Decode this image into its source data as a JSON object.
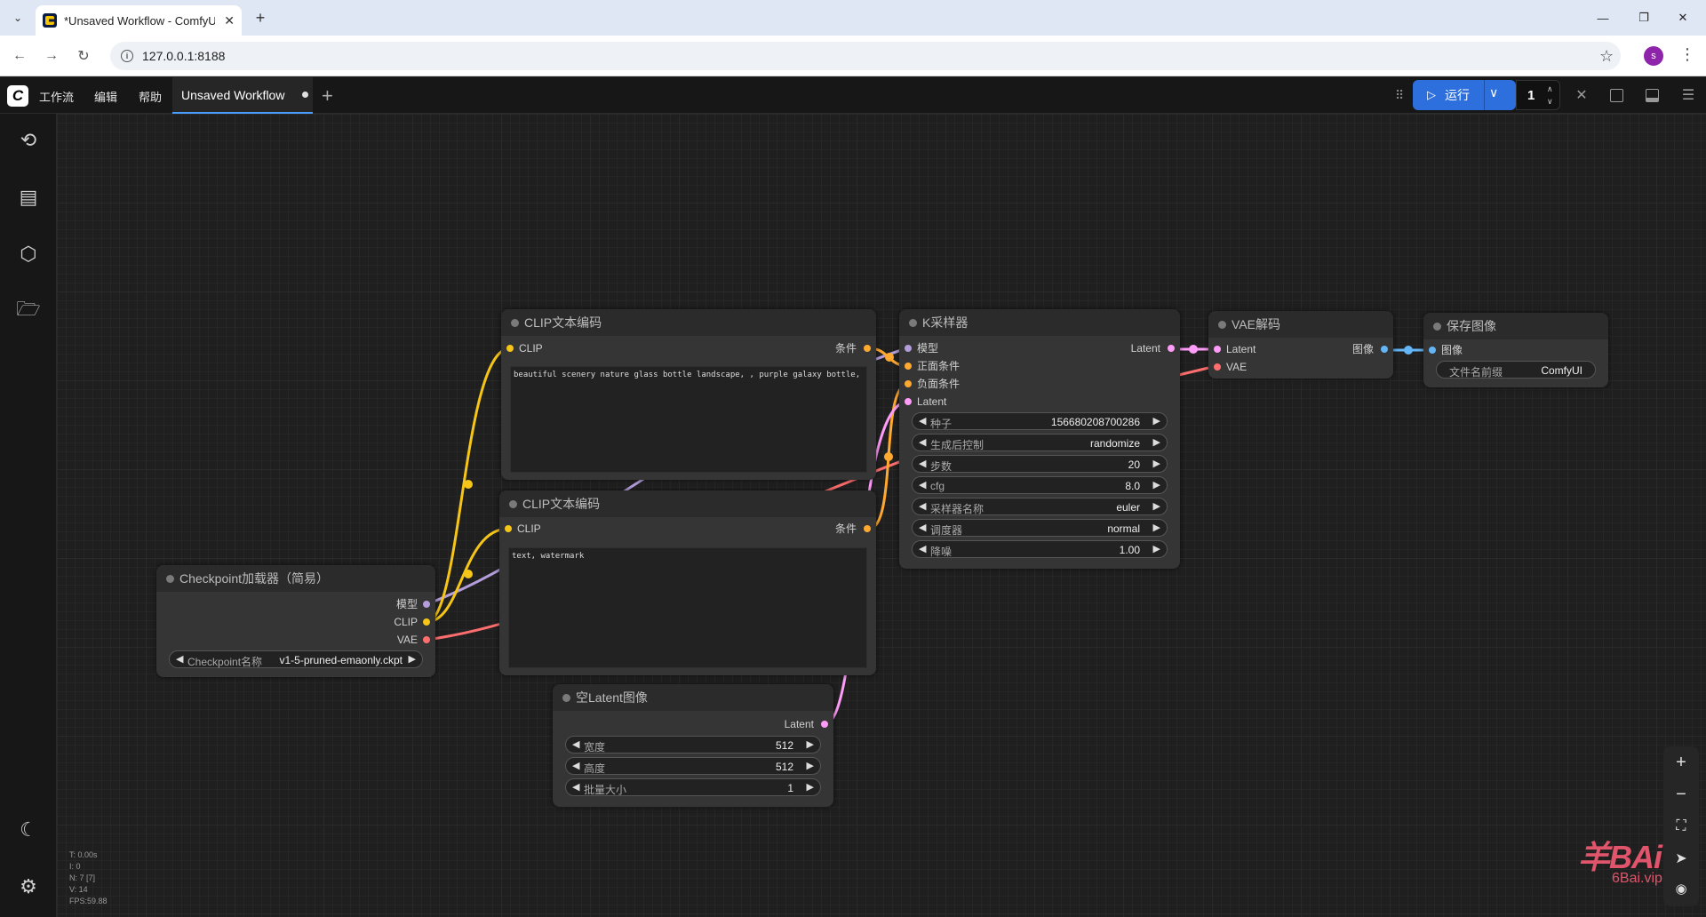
{
  "browser": {
    "tab_title": "*Unsaved Workflow - ComfyUI",
    "url": "127.0.0.1:8188",
    "profile_initial": "s"
  },
  "menubar": {
    "items": [
      "工作流",
      "编辑",
      "帮助"
    ],
    "workflow_tab": "Unsaved Workflow",
    "run_label": "运行",
    "batch_count": "1"
  },
  "nodes": {
    "clip1": {
      "title": "CLIP文本编码",
      "input": "CLIP",
      "output": "条件",
      "text": "beautiful scenery nature glass bottle landscape, , purple galaxy bottle,"
    },
    "clip2": {
      "title": "CLIP文本编码",
      "input": "CLIP",
      "output": "条件",
      "text": "text, watermark"
    },
    "checkpoint": {
      "title": "Checkpoint加载器（简易）",
      "outputs": [
        "模型",
        "CLIP",
        "VAE"
      ],
      "widget_label": "Checkpoint名称",
      "widget_value": "v1-5-pruned-emaonly.ckpt"
    },
    "ksampler": {
      "title": "K采样器",
      "inputs": [
        "模型",
        "正面条件",
        "负面条件",
        "Latent"
      ],
      "output": "Latent",
      "widgets": [
        {
          "label": "种子",
          "value": "156680208700286"
        },
        {
          "label": "生成后控制",
          "value": "randomize"
        },
        {
          "label": "步数",
          "value": "20"
        },
        {
          "label": "cfg",
          "value": "8.0"
        },
        {
          "label": "采样器名称",
          "value": "euler"
        },
        {
          "label": "调度器",
          "value": "normal"
        },
        {
          "label": "降噪",
          "value": "1.00"
        }
      ]
    },
    "vae": {
      "title": "VAE解码",
      "inputs": [
        "Latent",
        "VAE"
      ],
      "output": "图像"
    },
    "save": {
      "title": "保存图像",
      "input": "图像",
      "widget_label": "文件名前缀",
      "widget_value": "ComfyUI"
    },
    "latent": {
      "title": "空Latent图像",
      "output": "Latent",
      "widgets": [
        {
          "label": "宽度",
          "value": "512"
        },
        {
          "label": "高度",
          "value": "512"
        },
        {
          "label": "批量大小",
          "value": "1"
        }
      ]
    }
  },
  "stats": [
    "T: 0.00s",
    "I: 0",
    "N: 7 [7]",
    "V: 14",
    "FPS:59.88"
  ],
  "watermark": {
    "brand": "羊BAi",
    "sub": "6Bai.vip"
  },
  "colors": {
    "clip": "#f5c518",
    "model": "#b39ddb",
    "vae": "#ff6e6e",
    "conditioning": "#ffa931",
    "latent": "#ff9cf9",
    "image": "#64b5f6",
    "accent": "#2d6fdc"
  }
}
